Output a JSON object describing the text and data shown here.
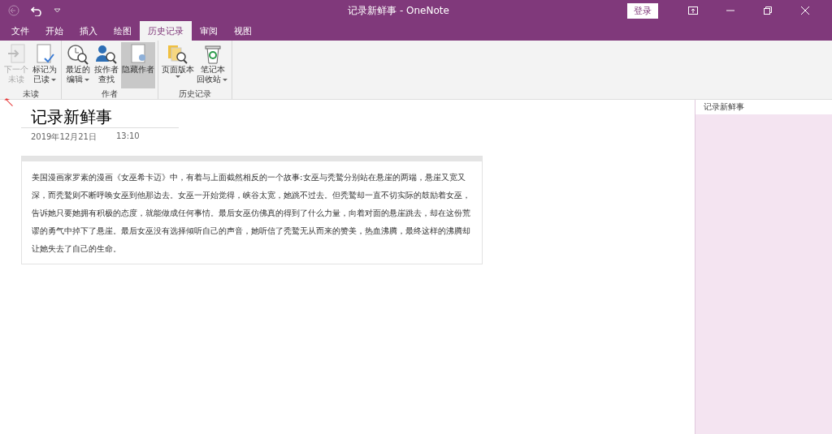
{
  "window": {
    "title": "记录新鲜事 - OneNote",
    "sign_in": "登录"
  },
  "tabs": [
    {
      "label": "文件",
      "selected": false
    },
    {
      "label": "开始",
      "selected": false
    },
    {
      "label": "插入",
      "selected": false
    },
    {
      "label": "绘图",
      "selected": false
    },
    {
      "label": "历史记录",
      "selected": true
    },
    {
      "label": "审阅",
      "selected": false
    },
    {
      "label": "视图",
      "selected": false
    }
  ],
  "ribbon_groups": [
    {
      "label": "未读",
      "buttons": [
        {
          "kind": "next",
          "lines": [
            "下一个",
            "未读"
          ],
          "disabled": true,
          "pressed": false,
          "dropdown": false
        },
        {
          "kind": "mark",
          "lines": [
            "标记为",
            "已读"
          ],
          "disabled": false,
          "pressed": false,
          "dropdown": true
        }
      ]
    },
    {
      "label": "作者",
      "buttons": [
        {
          "kind": "recent",
          "lines": [
            "最近的",
            "编辑"
          ],
          "disabled": false,
          "pressed": false,
          "dropdown": true
        },
        {
          "kind": "author",
          "lines": [
            "按作者",
            "查找"
          ],
          "disabled": false,
          "pressed": false,
          "dropdown": false
        },
        {
          "kind": "hide",
          "lines": [
            "隐藏作者"
          ],
          "disabled": false,
          "pressed": true,
          "dropdown": false
        }
      ]
    },
    {
      "label": "历史记录",
      "buttons": [
        {
          "kind": "versions",
          "lines": [
            "页面版本"
          ],
          "disabled": false,
          "pressed": false,
          "dropdown": true
        },
        {
          "kind": "recycle",
          "lines": [
            "笔记本",
            "回收站"
          ],
          "disabled": false,
          "pressed": false,
          "dropdown": true
        }
      ]
    }
  ],
  "page": {
    "title": "记录新鲜事",
    "date": "2019年12月21日",
    "time": "13:10",
    "body": "美国漫画家罗素的漫画《女巫希卡迈》中，有着与上面截然相反的一个故事:女巫与秃鹫分别站在悬崖的两端，悬崖又宽又深，而秃鹫则不断呼唤女巫到他那边去。女巫一开始觉得，峡谷太宽，她跳不过去。但秃鹫却一直不切实际的鼓励着女巫，告诉她只要她拥有积极的态度，就能做成任何事情。最后女巫仿佛真的得到了什么力量，向着对面的悬崖跳去，却在这份荒谬的勇气中掉下了悬崖。最后女巫没有选择倾听自己的声音，她听信了秃鹫无从而来的赞美，热血沸腾，最终这样的沸腾却让她失去了自己的生命。"
  },
  "page_list": [
    {
      "title": "记录新鲜事",
      "selected": true
    }
  ]
}
